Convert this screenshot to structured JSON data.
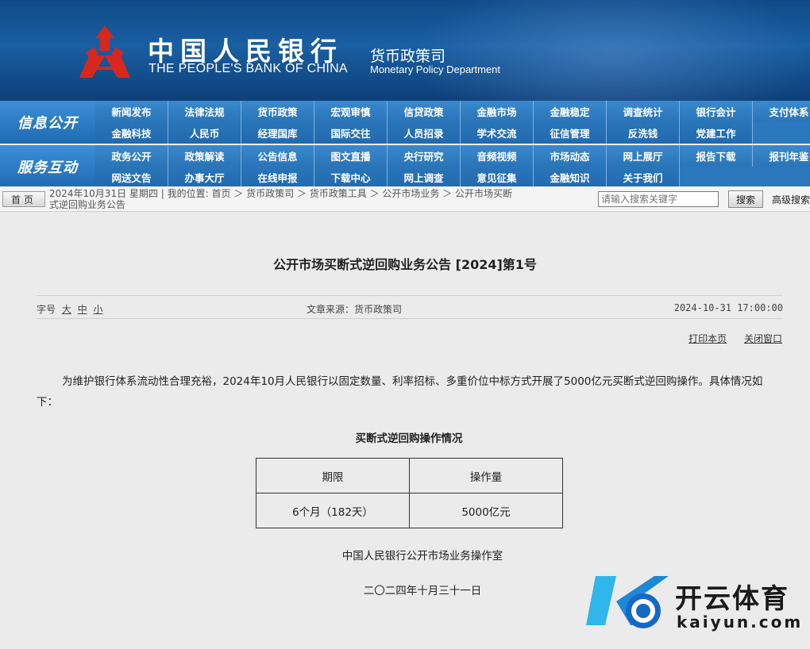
{
  "header": {
    "bank_name_cn": "中国人民银行",
    "bank_name_en": "THE PEOPLE'S BANK OF CHINA",
    "dept_cn": "货币政策司",
    "dept_en": "Monetary Policy Department"
  },
  "nav": {
    "section1_label": "信息公开",
    "section1_row1": [
      "新闻发布",
      "法律法规",
      "货币政策",
      "宏观审慎",
      "信贷政策",
      "金融市场",
      "金融稳定",
      "调查统计",
      "银行会计",
      "支付体系"
    ],
    "section1_row2": [
      "金融科技",
      "人民币",
      "经理国库",
      "国际交往",
      "人员招录",
      "学术交流",
      "征信管理",
      "反洗钱",
      "党建工作"
    ],
    "section2_label": "服务互动",
    "section2_row1": [
      "政务公开",
      "政策解读",
      "公告信息",
      "图文直播",
      "央行研究",
      "音频视频",
      "市场动态",
      "网上展厅",
      "报告下载",
      "报刊年鉴"
    ],
    "section2_row2": [
      "网送文告",
      "办事大厅",
      "在线申报",
      "下载中心",
      "网上调查",
      "意见征集",
      "金融知识",
      "关于我们"
    ]
  },
  "breadcrumb": {
    "home_label": "首页",
    "date": "2024年10月31日",
    "weekday": "星期四",
    "location_label": "我的位置:",
    "path_line1": "首页  ＞ 货币政策司  ＞ 货币政策工具  ＞ 公开市场业务  ＞ 公开市场买断",
    "path_line2": "式逆回购业务公告"
  },
  "search": {
    "placeholder": "请输入搜索关键字",
    "button": "搜索",
    "advanced": "高级搜索"
  },
  "article": {
    "title": "公开市场买断式逆回购业务公告 [2024]第1号",
    "font_label": "字号",
    "font_sizes": [
      "大",
      "中",
      "小"
    ],
    "source": "文章来源：货币政策司",
    "datetime": "2024-10-31  17:00:00",
    "print": "打印本页",
    "close": "关闭窗口",
    "body": "为维护银行体系流动性合理充裕，2024年10月人民银行以固定数量、利率招标、多重价位中标方式开展了5000亿元买断式逆回购操作。具体情况如下：",
    "table_title": "买断式逆回购操作情况",
    "table_headers": [
      "期限",
      "操作量"
    ],
    "table_row": [
      "6个月（182天）",
      "5000亿元"
    ],
    "signoff": "中国人民银行公开市场业务操作室",
    "sign_date": "二〇二四年十月三十一日"
  },
  "watermark": {
    "cn": "开云体育",
    "en": "kaiyun.com"
  }
}
